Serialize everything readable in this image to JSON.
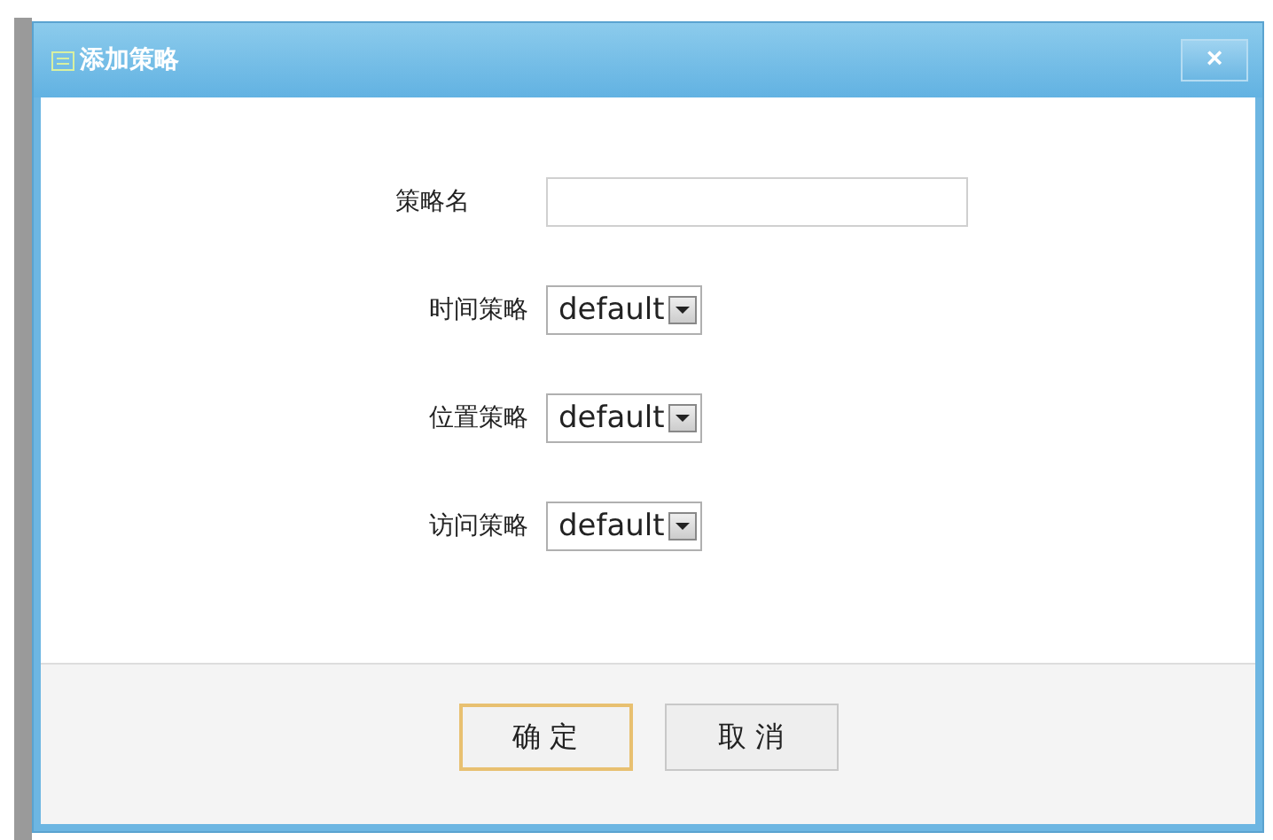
{
  "dialog": {
    "title": "添加策略",
    "close": "×"
  },
  "fields": [
    {
      "kind": "text",
      "label": "策略名"
    },
    {
      "kind": "select",
      "label": "时间策略",
      "value": "default"
    },
    {
      "kind": "select",
      "label": "位置策略",
      "value": "default"
    },
    {
      "kind": "select",
      "label": "访问策略",
      "value": "default"
    }
  ],
  "buttons": [
    {
      "label": "确 定",
      "focused": true
    },
    {
      "label": "取 消",
      "focused": false
    }
  ]
}
